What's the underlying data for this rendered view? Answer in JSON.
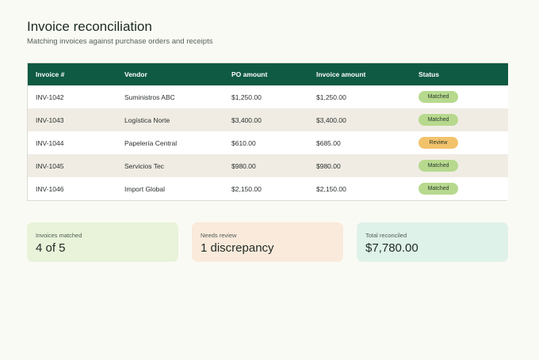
{
  "header": {
    "title": "Invoice reconciliation",
    "subtitle": "Matching invoices against purchase orders and receipts"
  },
  "table": {
    "columns": [
      "Invoice #",
      "Vendor",
      "PO amount",
      "Invoice amount",
      "Status"
    ],
    "rows": [
      {
        "invoice": "INV-1042",
        "vendor": "Suministros ABC",
        "po_amount": "$1,250.00",
        "invoice_amount": "$1,250.00",
        "status": "Matched",
        "status_type": "matched"
      },
      {
        "invoice": "INV-1043",
        "vendor": "Logística Norte",
        "po_amount": "$3,400.00",
        "invoice_amount": "$3,400.00",
        "status": "Matched",
        "status_type": "matched"
      },
      {
        "invoice": "INV-1044",
        "vendor": "Papelería Central",
        "po_amount": "$610.00",
        "invoice_amount": "$685.00",
        "status": "Review",
        "status_type": "review"
      },
      {
        "invoice": "INV-1045",
        "vendor": "Servicios Tec",
        "po_amount": "$980.00",
        "invoice_amount": "$980.00",
        "status": "Matched",
        "status_type": "matched"
      },
      {
        "invoice": "INV-1046",
        "vendor": "Import Global",
        "po_amount": "$2,150.00",
        "invoice_amount": "$2,150.00",
        "status": "Matched",
        "status_type": "matched"
      }
    ]
  },
  "summary": [
    {
      "label": "Invoices matched",
      "value": "4 of 5",
      "color": "#e8f3d9"
    },
    {
      "label": "Needs review",
      "value": "1 discrepancy",
      "color": "#faeadb"
    },
    {
      "label": "Total reconciled",
      "value": "$7,780.00",
      "color": "#dff2ea"
    }
  ],
  "colors": {
    "header_bg": "#0f5a43",
    "matched": "#b7d98e",
    "review": "#f2c26b",
    "page_bg": "#fafaf5"
  }
}
